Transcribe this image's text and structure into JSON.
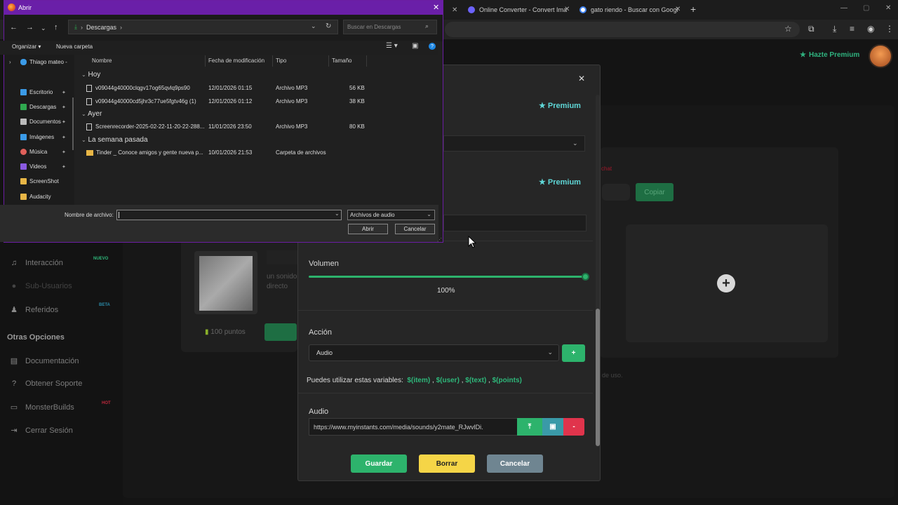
{
  "browser": {
    "tabs": [
      {
        "title": "Online Converter - Convert Ima",
        "favicon_color": "#6c63ff"
      },
      {
        "title": "gato riendo - Buscar con Googl",
        "favicon_color": "#4285f4"
      }
    ],
    "new_tab": "+"
  },
  "app": {
    "hazte_premium": "Hazte Premium",
    "sidebar": {
      "items": [
        {
          "label": "Interacción",
          "icon": "music-note-icon",
          "badge": "NUEVO"
        },
        {
          "label": "Sub-Usuarios",
          "icon": "users-icon",
          "badge": ""
        },
        {
          "label": "Referidos",
          "icon": "group-icon",
          "badge": "BETA"
        },
        {
          "label": "Documentación",
          "icon": "book-icon",
          "badge": ""
        },
        {
          "label": "Obtener Soporte",
          "icon": "help-icon",
          "badge": ""
        },
        {
          "label": "MonsterBuilds",
          "icon": "monitor-icon",
          "badge": "HOT"
        },
        {
          "label": "Cerrar Sesión",
          "icon": "logout-icon",
          "badge": ""
        }
      ],
      "section_title": "Otras Opciones"
    },
    "background": {
      "copy_button": "Copiar",
      "points": "100 puntos",
      "item_text_1": "un sonido",
      "item_text_2": "directo",
      "terms_text": "de uso."
    }
  },
  "modal": {
    "premium_label_1": "Premium",
    "premium_label_2": "Premium",
    "volume_label": "Volumen",
    "volume_value": "100%",
    "volume_level": 1.0,
    "action_label": "Acción",
    "action_selected": "Audio",
    "add_button": "+",
    "vars_prefix": "Puedes utilizar estas variables:",
    "variables": [
      "$(item)",
      "$(user)",
      "$(text)",
      "$(points)"
    ],
    "audio_label": "Audio",
    "audio_url": "https://www.myinstants.com/media/sounds/y2mate_RJwvlDi.",
    "remove_button": "-",
    "buttons": {
      "save": "Guardar",
      "delete": "Borrar",
      "cancel": "Cancelar"
    },
    "colors": {
      "green": "#2db36c",
      "yellow": "#f5d547",
      "grey": "#6f8591",
      "red": "#e0344c",
      "teal": "#3a9aa8"
    }
  },
  "dialog": {
    "title": "Abrir",
    "path": "Descargas",
    "search_placeholder": "Buscar en Descargas",
    "organize": "Organizar",
    "new_folder": "Nueva carpeta",
    "nav": [
      {
        "label": "Thiago mateo -",
        "icon": "cloud-icon",
        "color": "#3b9be8"
      },
      {
        "label": "Escritorio",
        "icon": "desktop-icon",
        "color": "#3b9be8"
      },
      {
        "label": "Descargas",
        "icon": "download-icon",
        "color": "#2fa84f"
      },
      {
        "label": "Documentos",
        "icon": "document-icon",
        "color": "#bbbbbb"
      },
      {
        "label": "Imágenes",
        "icon": "image-icon",
        "color": "#3b9be8"
      },
      {
        "label": "Música",
        "icon": "music-icon",
        "color": "#e0605a"
      },
      {
        "label": "Videos",
        "icon": "video-icon",
        "color": "#8a5ae0"
      },
      {
        "label": "ScreenShot",
        "icon": "folder-icon",
        "color": "#e8b646"
      },
      {
        "label": "Audacity",
        "icon": "folder-icon",
        "color": "#e8b646"
      }
    ],
    "columns": {
      "name": "Nombre",
      "date": "Fecha de modificación",
      "type": "Tipo",
      "size": "Tamaño"
    },
    "groups": {
      "today": "Hoy",
      "yesterday": "Ayer",
      "last_week": "La semana pasada"
    },
    "files": [
      {
        "name": "v09044g40000clqgv17og65qvlq9ps90",
        "date": "12/01/2026 01:15",
        "type": "Archivo MP3",
        "size": "56 KB"
      },
      {
        "name": "v09044g40000cd5jhr3c77ue5fgtv46g (1)",
        "date": "12/01/2026 01:12",
        "type": "Archivo MP3",
        "size": "38 KB"
      },
      {
        "name": "Screenrecorder-2025-02-22-11-20-22-288...",
        "date": "11/01/2026 23:50",
        "type": "Archivo MP3",
        "size": "80 KB"
      },
      {
        "name": "Tinder _ Conoce amigos y gente nueva p...",
        "date": "10/01/2026 21:53",
        "type": "Carpeta de archivos",
        "size": ""
      }
    ],
    "filename_label": "Nombre de archivo:",
    "filename_value": "",
    "filetype": "Archivos de audio",
    "open_button": "Abrir",
    "cancel_button": "Cancelar"
  }
}
